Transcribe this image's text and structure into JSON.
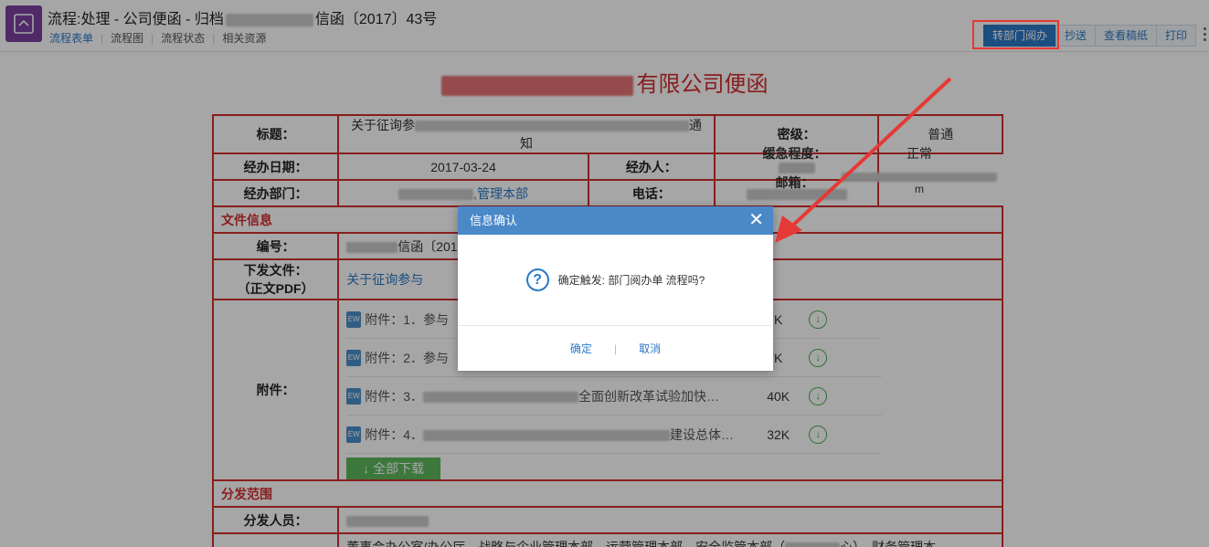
{
  "header": {
    "title_prefix": "流程:处理 - 公司便函 - 归档",
    "title_suffix": "信函〔2017〕43号",
    "tabs": [
      "流程表单",
      "流程图",
      "流程状态",
      "相关资源"
    ],
    "actions": [
      "转部门阅办",
      "抄送",
      "查看稿纸",
      "打印"
    ]
  },
  "document": {
    "title_suffix": "有限公司便函",
    "fields": {
      "subject_label": "标题：",
      "subject_prefix": "关于征询参",
      "subject_suffix": "通知",
      "secrecy_label": "密级：",
      "secrecy_value": "普通",
      "date_label": "经办日期：",
      "date_value": "2017-03-24",
      "handler_label": "经办人：",
      "urgency_label": "缓急程度：",
      "urgency_value": "正常",
      "dept_label": "经办部门：",
      "dept_value": ",管理本部",
      "phone_label": "电话：",
      "email_label": "邮箱：",
      "email_tail": "m",
      "file_info": "文件信息",
      "number_label": "编号：",
      "number_value": "信函〔201",
      "issued_label_1": "下发文件：",
      "issued_label_2": "（正文PDF）",
      "issued_value": "关于征询参与",
      "attach_label": "附件：",
      "dist_scope": "分发范围",
      "dist_people_label": "分发人员：",
      "bottom_text": "董事会办公室/办公厅、战略与企业管理本部、运营管理本部、安全监管本部（",
      "bottom_text_tail": "心）、财务管理本"
    },
    "attachments": [
      {
        "name": "附件：1．参与",
        "size": "7K"
      },
      {
        "name": "附件：2．参与",
        "size": "7K"
      },
      {
        "name": "附件：3．",
        "name_tail": "全面创新改革试验加快…",
        "size": "40K"
      },
      {
        "name": "附件：4．",
        "name_tail": "建设总体…",
        "size": "32K"
      }
    ],
    "download_all": "↓ 全部下载"
  },
  "dialog": {
    "title": "信息确认",
    "message": "确定触发: 部门阅办单 流程吗?",
    "ok": "确定",
    "cancel": "取消",
    "separator": "|"
  },
  "colors": {
    "brand": "#7b3fa0",
    "accent": "#2b78c5",
    "doc_red": "#d32f2f",
    "highlight": "#e53935"
  }
}
